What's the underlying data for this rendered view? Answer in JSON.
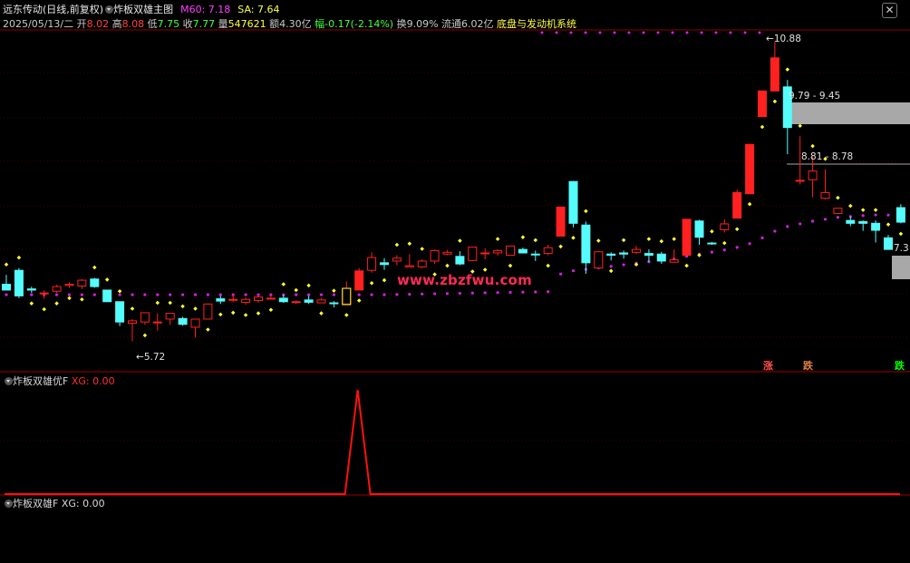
{
  "header": {
    "stock_name": "远东传动(日线,前复权)",
    "indicator_name": "炸板双雄主图",
    "m60_label": "M60: 7.18",
    "sa_label": "SA: 7.64",
    "date": "2025/05/13/二",
    "open_label": "开",
    "open_value": "8.02",
    "high_label": "高",
    "high_value": "8.08",
    "low_label": "低",
    "low_value": "7.75",
    "close_label": "收",
    "close_value": "7.77",
    "volume_label": "量",
    "volume_value": "547621",
    "amount_label": "额",
    "amount_value": "4.30亿",
    "change_label": "幅",
    "change_value": "-0.17(-2.14%)",
    "turnover_label": "换",
    "turnover_value": "9.09%",
    "float_label": "流通",
    "float_value": "6.02亿",
    "system_name": "底盘与发动机系统"
  },
  "main_chart": {
    "labels": {
      "low_marker": "5.72",
      "high_marker": "10.88",
      "zone_upper": "9.79 - 9.45",
      "zone_lower": "8.81 - 8.78",
      "last_price": "7.3"
    },
    "badges": [
      {
        "text": "涨",
        "color": "#ff5050"
      },
      {
        "text": "跌",
        "color": "#e08040"
      },
      {
        "text": "跌",
        "color": "#00ff00"
      }
    ],
    "watermark": "www.zbzfwu.com",
    "colors": {
      "up": "#ff2020",
      "down": "#54fcfc",
      "dot_yellow": "#ffff30",
      "dot_magenta": "#d020e0"
    }
  },
  "panel2": {
    "title": "炸板双雄优F",
    "xg_label": "XG: 0.00"
  },
  "panel3": {
    "title": "炸板双雄F",
    "xg_label": "XG: 0.00"
  },
  "chart_data": {
    "type": "candlestick",
    "ohlc": [
      [
        6.7,
        6.86,
        6.65,
        6.6
      ],
      [
        6.94,
        6.98,
        6.46,
        6.5
      ],
      [
        6.62,
        6.66,
        6.55,
        6.6
      ],
      [
        6.55,
        6.6,
        6.45,
        6.55
      ],
      [
        6.58,
        6.69,
        6.55,
        6.66
      ],
      [
        6.68,
        6.73,
        6.64,
        6.7
      ],
      [
        6.67,
        6.79,
        6.62,
        6.77
      ],
      [
        6.79,
        6.81,
        6.64,
        6.66
      ],
      [
        6.6,
        6.6,
        6.4,
        6.4
      ],
      [
        6.4,
        6.4,
        5.98,
        6.05
      ],
      [
        6.03,
        6.1,
        5.72,
        6.07
      ],
      [
        6.05,
        6.21,
        6.0,
        6.21
      ],
      [
        6.05,
        6.2,
        5.9,
        6.05
      ],
      [
        6.1,
        6.2,
        6.0,
        6.2
      ],
      [
        6.11,
        6.14,
        5.99,
        6.01
      ],
      [
        5.96,
        6.1,
        5.78,
        6.1
      ],
      [
        6.1,
        6.37,
        6.1,
        6.36
      ],
      [
        6.45,
        6.5,
        6.36,
        6.41
      ],
      [
        6.43,
        6.52,
        6.39,
        6.44
      ],
      [
        6.39,
        6.47,
        6.35,
        6.44
      ],
      [
        6.42,
        6.5,
        6.38,
        6.48
      ],
      [
        6.45,
        6.5,
        6.44,
        6.46
      ],
      [
        6.46,
        6.52,
        6.38,
        6.4
      ],
      [
        6.39,
        6.42,
        6.36,
        6.4
      ],
      [
        6.43,
        6.5,
        6.36,
        6.39
      ],
      [
        6.38,
        6.46,
        6.38,
        6.43
      ],
      [
        6.38,
        6.41,
        6.3,
        6.37
      ],
      [
        6.36,
        6.75,
        6.35,
        6.63
      ],
      [
        6.6,
        6.98,
        6.6,
        6.93
      ],
      [
        6.94,
        7.25,
        6.9,
        7.16
      ],
      [
        7.07,
        7.15,
        6.95,
        7.04
      ],
      [
        7.1,
        7.2,
        7.03,
        7.15
      ],
      [
        7.0,
        7.22,
        7.0,
        7.02
      ],
      [
        7.0,
        7.13,
        6.98,
        7.1
      ],
      [
        7.1,
        7.3,
        7.05,
        7.28
      ],
      [
        7.22,
        7.29,
        7.2,
        7.25
      ],
      [
        7.18,
        7.27,
        7.03,
        7.05
      ],
      [
        7.11,
        7.34,
        7.1,
        7.34
      ],
      [
        7.24,
        7.32,
        7.13,
        7.24
      ],
      [
        7.24,
        7.3,
        7.19,
        7.28
      ],
      [
        7.2,
        7.36,
        7.2,
        7.36
      ],
      [
        7.3,
        7.33,
        7.23,
        7.24
      ],
      [
        7.22,
        7.28,
        7.1,
        7.21
      ],
      [
        7.23,
        7.38,
        7.2,
        7.33
      ],
      [
        7.53,
        8.03,
        7.53,
        8.03
      ],
      [
        8.47,
        8.48,
        7.68,
        7.75
      ],
      [
        7.72,
        7.78,
        6.88,
        7.07
      ],
      [
        6.98,
        7.27,
        6.98,
        7.26
      ],
      [
        7.22,
        7.25,
        7.11,
        7.2
      ],
      [
        7.24,
        7.28,
        7.14,
        7.22
      ],
      [
        7.25,
        7.36,
        7.22,
        7.3
      ],
      [
        7.23,
        7.3,
        7.08,
        7.2
      ],
      [
        7.22,
        7.26,
        7.05,
        7.1
      ],
      [
        7.08,
        7.3,
        7.07,
        7.12
      ],
      [
        7.2,
        7.82,
        7.2,
        7.82
      ],
      [
        7.79,
        7.81,
        7.38,
        7.51
      ],
      [
        7.41,
        7.43,
        7.38,
        7.4
      ],
      [
        7.64,
        7.82,
        7.59,
        7.74
      ],
      [
        7.84,
        8.33,
        7.83,
        8.28
      ],
      [
        8.26,
        9.11,
        8.26,
        9.11
      ],
      [
        9.59,
        10.03,
        9.59,
        10.03
      ],
      [
        10.03,
        10.88,
        10.03,
        10.6
      ],
      [
        10.1,
        10.22,
        8.94,
        9.4
      ],
      [
        8.49,
        9.25,
        8.42,
        8.49
      ],
      [
        8.5,
        8.9,
        8.2,
        8.65
      ],
      [
        8.18,
        8.68,
        8.16,
        8.28
      ],
      [
        7.92,
        8.01,
        7.91,
        8.01
      ],
      [
        7.8,
        7.87,
        7.7,
        7.75
      ],
      [
        7.78,
        7.8,
        7.62,
        7.75
      ],
      [
        7.75,
        7.8,
        7.42,
        7.63
      ],
      [
        7.5,
        7.55,
        7.35,
        7.3
      ],
      [
        8.02,
        8.08,
        7.75,
        7.77
      ]
    ],
    "panel2_spike": {
      "index": 28,
      "value": 1
    },
    "panel3_value": 0
  }
}
